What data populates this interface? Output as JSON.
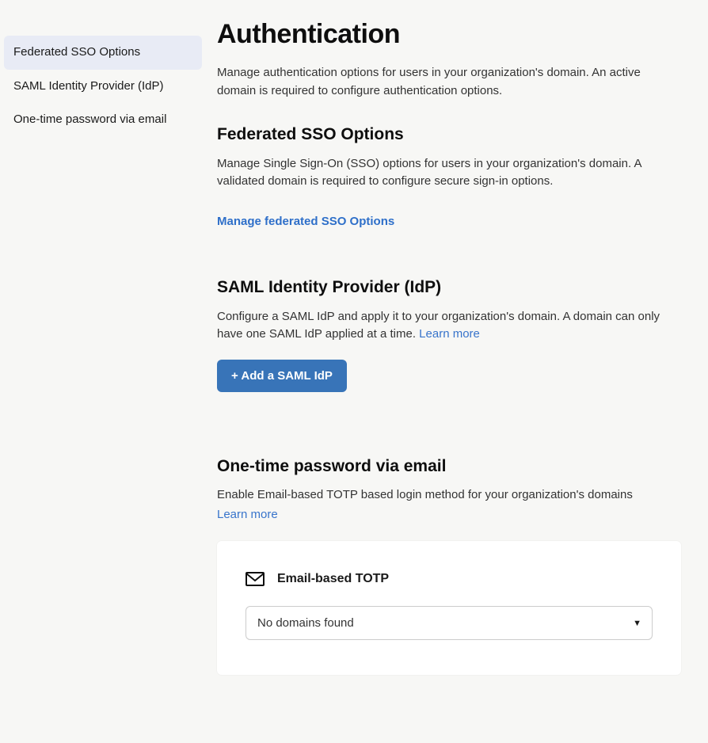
{
  "sidebar": {
    "items": [
      {
        "label": "Federated SSO Options",
        "active": true
      },
      {
        "label": "SAML Identity Provider (IdP)",
        "active": false
      },
      {
        "label": "One-time password via email",
        "active": false
      }
    ]
  },
  "page": {
    "title": "Authentication",
    "description": "Manage authentication options for users in your organization's domain. An active domain is required to configure authentication options."
  },
  "sections": {
    "sso": {
      "title": "Federated SSO Options",
      "description": "Manage Single Sign-On (SSO) options for users in your organization's domain. A validated domain is required to configure secure sign-in options.",
      "manage_link": "Manage federated SSO Options"
    },
    "saml": {
      "title": "SAML Identity Provider (IdP)",
      "description": "Configure a SAML IdP and apply it to your organization's domain. A domain can only have one SAML IdP applied at a time. ",
      "learn_more": "Learn more",
      "add_button": "+ Add a SAML IdP"
    },
    "otp": {
      "title": "One-time password via email",
      "description": "Enable Email-based TOTP based login method for your organization's domains",
      "learn_more": "Learn more",
      "card": {
        "title": "Email-based TOTP",
        "select_value": "No domains found"
      }
    }
  }
}
